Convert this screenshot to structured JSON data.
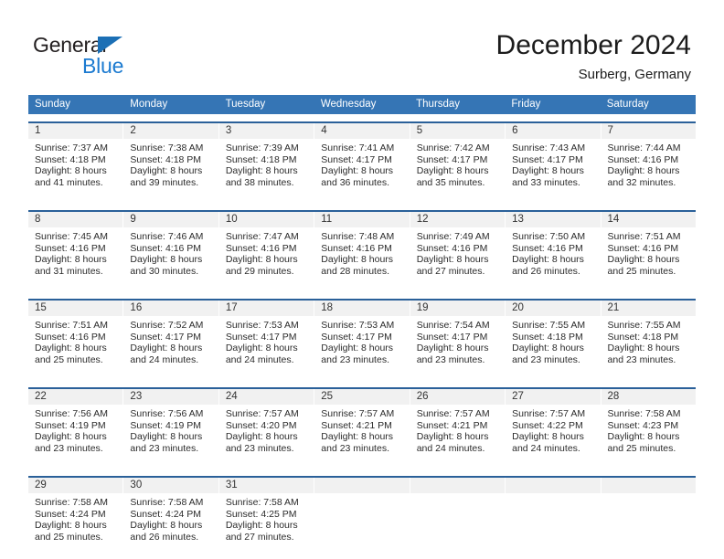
{
  "brand": {
    "name_part1": "General",
    "name_part2": "Blue",
    "triangle_icon": "triangle-icon",
    "color_dark": "#231f20",
    "color_blue": "#1b7ad0"
  },
  "header": {
    "month_title": "December 2024",
    "location": "Surberg, Germany"
  },
  "theme": {
    "header_blue": "#3575b5",
    "week_rule_blue": "#2a6099",
    "daynum_band": "#f1f1f1"
  },
  "weekdays": [
    {
      "label": "Sunday"
    },
    {
      "label": "Monday"
    },
    {
      "label": "Tuesday"
    },
    {
      "label": "Wednesday"
    },
    {
      "label": "Thursday"
    },
    {
      "label": "Friday"
    },
    {
      "label": "Saturday"
    }
  ],
  "weeks": [
    {
      "days": [
        {
          "num": "1",
          "sunrise": "Sunrise: 7:37 AM",
          "sunset": "Sunset: 4:18 PM",
          "daylight1": "Daylight: 8 hours",
          "daylight2": "and 41 minutes."
        },
        {
          "num": "2",
          "sunrise": "Sunrise: 7:38 AM",
          "sunset": "Sunset: 4:18 PM",
          "daylight1": "Daylight: 8 hours",
          "daylight2": "and 39 minutes."
        },
        {
          "num": "3",
          "sunrise": "Sunrise: 7:39 AM",
          "sunset": "Sunset: 4:18 PM",
          "daylight1": "Daylight: 8 hours",
          "daylight2": "and 38 minutes."
        },
        {
          "num": "4",
          "sunrise": "Sunrise: 7:41 AM",
          "sunset": "Sunset: 4:17 PM",
          "daylight1": "Daylight: 8 hours",
          "daylight2": "and 36 minutes."
        },
        {
          "num": "5",
          "sunrise": "Sunrise: 7:42 AM",
          "sunset": "Sunset: 4:17 PM",
          "daylight1": "Daylight: 8 hours",
          "daylight2": "and 35 minutes."
        },
        {
          "num": "6",
          "sunrise": "Sunrise: 7:43 AM",
          "sunset": "Sunset: 4:17 PM",
          "daylight1": "Daylight: 8 hours",
          "daylight2": "and 33 minutes."
        },
        {
          "num": "7",
          "sunrise": "Sunrise: 7:44 AM",
          "sunset": "Sunset: 4:16 PM",
          "daylight1": "Daylight: 8 hours",
          "daylight2": "and 32 minutes."
        }
      ]
    },
    {
      "days": [
        {
          "num": "8",
          "sunrise": "Sunrise: 7:45 AM",
          "sunset": "Sunset: 4:16 PM",
          "daylight1": "Daylight: 8 hours",
          "daylight2": "and 31 minutes."
        },
        {
          "num": "9",
          "sunrise": "Sunrise: 7:46 AM",
          "sunset": "Sunset: 4:16 PM",
          "daylight1": "Daylight: 8 hours",
          "daylight2": "and 30 minutes."
        },
        {
          "num": "10",
          "sunrise": "Sunrise: 7:47 AM",
          "sunset": "Sunset: 4:16 PM",
          "daylight1": "Daylight: 8 hours",
          "daylight2": "and 29 minutes."
        },
        {
          "num": "11",
          "sunrise": "Sunrise: 7:48 AM",
          "sunset": "Sunset: 4:16 PM",
          "daylight1": "Daylight: 8 hours",
          "daylight2": "and 28 minutes."
        },
        {
          "num": "12",
          "sunrise": "Sunrise: 7:49 AM",
          "sunset": "Sunset: 4:16 PM",
          "daylight1": "Daylight: 8 hours",
          "daylight2": "and 27 minutes."
        },
        {
          "num": "13",
          "sunrise": "Sunrise: 7:50 AM",
          "sunset": "Sunset: 4:16 PM",
          "daylight1": "Daylight: 8 hours",
          "daylight2": "and 26 minutes."
        },
        {
          "num": "14",
          "sunrise": "Sunrise: 7:51 AM",
          "sunset": "Sunset: 4:16 PM",
          "daylight1": "Daylight: 8 hours",
          "daylight2": "and 25 minutes."
        }
      ]
    },
    {
      "days": [
        {
          "num": "15",
          "sunrise": "Sunrise: 7:51 AM",
          "sunset": "Sunset: 4:16 PM",
          "daylight1": "Daylight: 8 hours",
          "daylight2": "and 25 minutes."
        },
        {
          "num": "16",
          "sunrise": "Sunrise: 7:52 AM",
          "sunset": "Sunset: 4:17 PM",
          "daylight1": "Daylight: 8 hours",
          "daylight2": "and 24 minutes."
        },
        {
          "num": "17",
          "sunrise": "Sunrise: 7:53 AM",
          "sunset": "Sunset: 4:17 PM",
          "daylight1": "Daylight: 8 hours",
          "daylight2": "and 24 minutes."
        },
        {
          "num": "18",
          "sunrise": "Sunrise: 7:53 AM",
          "sunset": "Sunset: 4:17 PM",
          "daylight1": "Daylight: 8 hours",
          "daylight2": "and 23 minutes."
        },
        {
          "num": "19",
          "sunrise": "Sunrise: 7:54 AM",
          "sunset": "Sunset: 4:17 PM",
          "daylight1": "Daylight: 8 hours",
          "daylight2": "and 23 minutes."
        },
        {
          "num": "20",
          "sunrise": "Sunrise: 7:55 AM",
          "sunset": "Sunset: 4:18 PM",
          "daylight1": "Daylight: 8 hours",
          "daylight2": "and 23 minutes."
        },
        {
          "num": "21",
          "sunrise": "Sunrise: 7:55 AM",
          "sunset": "Sunset: 4:18 PM",
          "daylight1": "Daylight: 8 hours",
          "daylight2": "and 23 minutes."
        }
      ]
    },
    {
      "days": [
        {
          "num": "22",
          "sunrise": "Sunrise: 7:56 AM",
          "sunset": "Sunset: 4:19 PM",
          "daylight1": "Daylight: 8 hours",
          "daylight2": "and 23 minutes."
        },
        {
          "num": "23",
          "sunrise": "Sunrise: 7:56 AM",
          "sunset": "Sunset: 4:19 PM",
          "daylight1": "Daylight: 8 hours",
          "daylight2": "and 23 minutes."
        },
        {
          "num": "24",
          "sunrise": "Sunrise: 7:57 AM",
          "sunset": "Sunset: 4:20 PM",
          "daylight1": "Daylight: 8 hours",
          "daylight2": "and 23 minutes."
        },
        {
          "num": "25",
          "sunrise": "Sunrise: 7:57 AM",
          "sunset": "Sunset: 4:21 PM",
          "daylight1": "Daylight: 8 hours",
          "daylight2": "and 23 minutes."
        },
        {
          "num": "26",
          "sunrise": "Sunrise: 7:57 AM",
          "sunset": "Sunset: 4:21 PM",
          "daylight1": "Daylight: 8 hours",
          "daylight2": "and 24 minutes."
        },
        {
          "num": "27",
          "sunrise": "Sunrise: 7:57 AM",
          "sunset": "Sunset: 4:22 PM",
          "daylight1": "Daylight: 8 hours",
          "daylight2": "and 24 minutes."
        },
        {
          "num": "28",
          "sunrise": "Sunrise: 7:58 AM",
          "sunset": "Sunset: 4:23 PM",
          "daylight1": "Daylight: 8 hours",
          "daylight2": "and 25 minutes."
        }
      ]
    },
    {
      "days": [
        {
          "num": "29",
          "sunrise": "Sunrise: 7:58 AM",
          "sunset": "Sunset: 4:24 PM",
          "daylight1": "Daylight: 8 hours",
          "daylight2": "and 25 minutes."
        },
        {
          "num": "30",
          "sunrise": "Sunrise: 7:58 AM",
          "sunset": "Sunset: 4:24 PM",
          "daylight1": "Daylight: 8 hours",
          "daylight2": "and 26 minutes."
        },
        {
          "num": "31",
          "sunrise": "Sunrise: 7:58 AM",
          "sunset": "Sunset: 4:25 PM",
          "daylight1": "Daylight: 8 hours",
          "daylight2": "and 27 minutes."
        },
        {
          "num": "",
          "sunrise": "",
          "sunset": "",
          "daylight1": "",
          "daylight2": ""
        },
        {
          "num": "",
          "sunrise": "",
          "sunset": "",
          "daylight1": "",
          "daylight2": ""
        },
        {
          "num": "",
          "sunrise": "",
          "sunset": "",
          "daylight1": "",
          "daylight2": ""
        },
        {
          "num": "",
          "sunrise": "",
          "sunset": "",
          "daylight1": "",
          "daylight2": ""
        }
      ]
    }
  ]
}
